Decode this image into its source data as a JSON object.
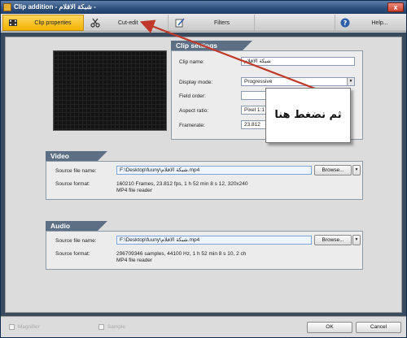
{
  "window": {
    "title": "Clip addition - شبكة الاقلام -",
    "close_label": "x"
  },
  "tabs": [
    {
      "label": "Clip properties",
      "icon": "film-icon",
      "active": true
    },
    {
      "label": "Cut-edit",
      "icon": "scissors-icon",
      "active": false
    },
    {
      "label": "Filters",
      "icon": "pen-icon",
      "active": false
    },
    {
      "label": "Help...",
      "icon": "help-icon",
      "active": false
    }
  ],
  "clip_settings": {
    "header": "Clip settings",
    "clip_name_label": "Clip name:",
    "clip_name_value": "شبكة الاقلام",
    "display_mode_label": "Display mode:",
    "display_mode_value": "Progressive",
    "field_order_label": "Field order:",
    "aspect_ratio_label": "Aspect ratio:",
    "aspect_ratio_value": "Pixel 1:1 (",
    "framerate_label": "Framerate:",
    "framerate_value": "23.812"
  },
  "video": {
    "header": "Video",
    "source_file_label": "Source file name:",
    "source_file_value": "F:\\Desktop\\fuuny\\شبكة الاقلام.mp4",
    "browse_label": "Browse...",
    "source_format_label": "Source format:",
    "format_line1": "160210  Frames,  23.812  fps,  1 h 52 min 8 s 12,  320x240",
    "format_line2": "MP4 file reader"
  },
  "audio": {
    "header": "Audio",
    "source_file_label": "Source file name:",
    "source_file_value": "F:\\Desktop\\fuuny\\شبكة الاقلام.mp4",
    "browse_label": "Browse...",
    "source_format_label": "Source format:",
    "format_line1": "296709346  samples,  44100  Hz,  1 h 52 min 8 s 10,  2 ch",
    "format_line2": "MP4 file reader"
  },
  "footer": {
    "checkbox1": "Magnifier",
    "checkbox2": "Sample",
    "ok_label": "OK",
    "cancel_label": "Cancel"
  },
  "annotation": {
    "text": "ثم نضغط هنا",
    "color": "#c0392b"
  }
}
